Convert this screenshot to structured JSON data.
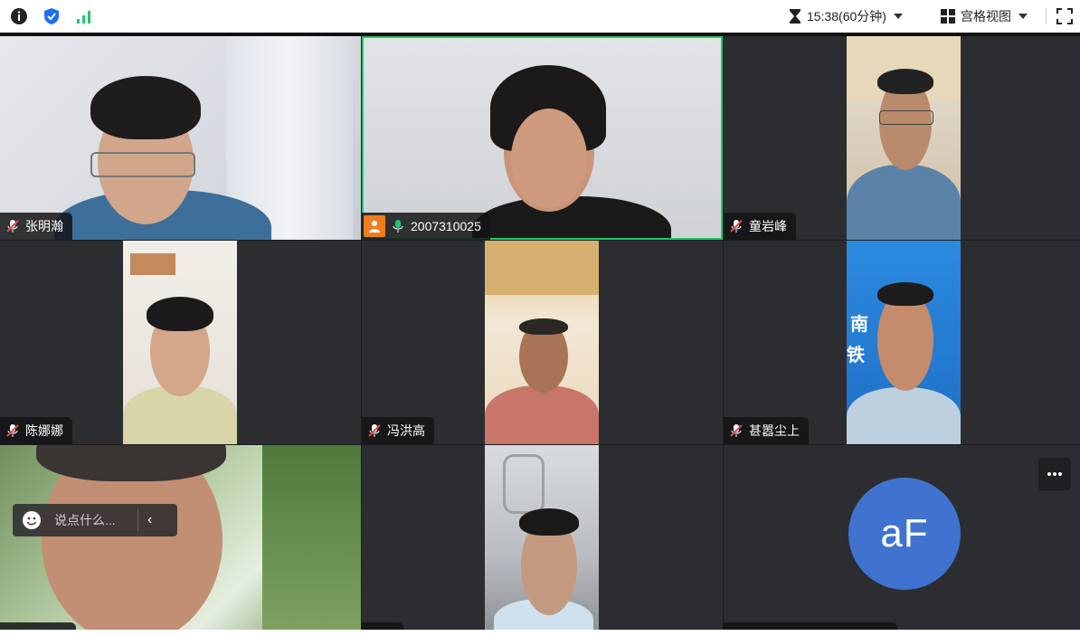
{
  "topbar": {
    "timer": "15:38(60分钟)",
    "view_mode": "宫格视图"
  },
  "participants": [
    {
      "name": "张明瀚",
      "muted": true
    },
    {
      "name": "2007310025",
      "muted": false,
      "host": true,
      "speaking": true
    },
    {
      "name": "童岩峰",
      "muted": true
    },
    {
      "name": "陈娜娜",
      "muted": true
    },
    {
      "name": "冯洪高",
      "muted": true
    },
    {
      "name": "甚嚣尘上",
      "muted": true
    }
  ],
  "video_overlay_text": {
    "banner_top": "南",
    "banner_bottom": "铁"
  },
  "avatar_tile": {
    "initials": "aF",
    "color": "#3f73cf"
  },
  "chat": {
    "placeholder": "说点什么..."
  },
  "colors": {
    "active_speaker_border": "#1ec96b",
    "host_badge": "#f07d1c",
    "grid_bg": "#2c2d31"
  }
}
